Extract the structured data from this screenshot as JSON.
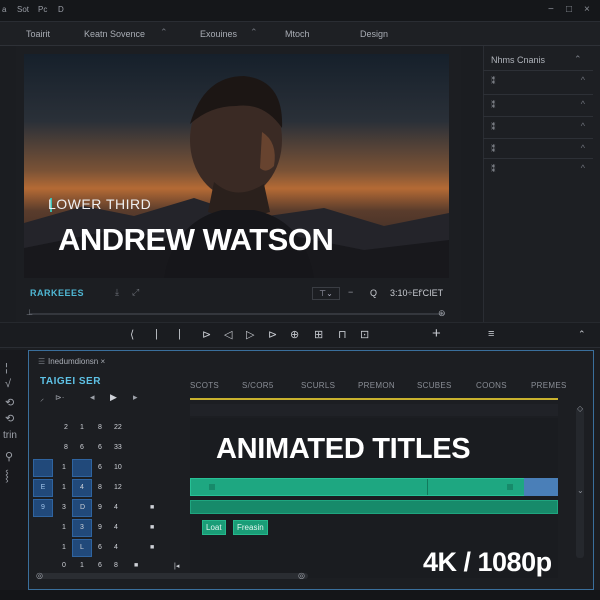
{
  "menubar": {
    "items": [
      "a",
      "Sot",
      "Pc",
      "D"
    ],
    "window_controls": [
      "−",
      "□",
      "×"
    ]
  },
  "tabs": [
    "Toairit",
    "Keatn Sovence",
    "Exouines",
    "Mtoch",
    "Design"
  ],
  "viewer": {
    "lower_third_label": "LOWER THIRD",
    "lower_third_name": "ANDREW WATSON",
    "sequence_name": "RARKEEES",
    "timecode": "3:10÷Ef'CIET",
    "zoom_icon": "Q"
  },
  "transport": {
    "icons": [
      "marker-in-icon",
      "step-back-icon",
      "marker-out-icon",
      "play-in-icon",
      "step-prev-icon",
      "play-icon",
      "step-next-icon",
      "insert-icon",
      "overwrite-icon",
      "lift-icon",
      "export-frame-icon",
      "add-icon"
    ],
    "glyphs": [
      "⟨",
      "|",
      "|",
      "⊳",
      "◁",
      "▷",
      "⊳",
      "⊕",
      "⊞",
      "⊓",
      "⊡",
      "+"
    ]
  },
  "right_panel": {
    "title": "Nhms Cnanis",
    "rows": [
      {
        "left": "⁑",
        "right": "^"
      },
      {
        "left": "⁑",
        "right": "^"
      },
      {
        "left": "⁑",
        "right": "^"
      },
      {
        "left": "⁑",
        "right": "^"
      },
      {
        "left": "⁑",
        "right": "^"
      }
    ]
  },
  "timeline": {
    "title": "Inedumdionsn ×",
    "sequence_name": "TAIGEI SER",
    "headers": [
      "SCOTS",
      "S/COR5",
      "SCURLS",
      "PREMON",
      "SCUBES",
      "COONS",
      "PREMES"
    ],
    "track_rows": [
      [
        "2",
        "1",
        "8",
        "22"
      ],
      [
        "8",
        "6",
        "6",
        "33"
      ],
      [
        "1",
        "",
        "6",
        "10"
      ],
      [
        "1",
        "4",
        "8",
        "12"
      ],
      [
        "3",
        "D",
        "9",
        "4"
      ],
      [
        "1",
        "3",
        "9",
        "4"
      ],
      [
        "1",
        "L",
        "6",
        "4"
      ],
      [
        "0",
        "1",
        "6",
        "8"
      ]
    ],
    "chips": [
      "Loat",
      "Freasin"
    ],
    "overlay_title": "ANIMATED TITLES",
    "resolution": "4K / 1080p"
  },
  "tools": [
    "¦",
    "√",
    "⟲",
    "⟲",
    "trin",
    "⚲",
    "⸾"
  ],
  "colors": {
    "accent_teal": "#1ea781",
    "accent_blue": "#4fb7d4",
    "timeline_border": "#3a6f9c",
    "header_line": "#c9b22e"
  }
}
